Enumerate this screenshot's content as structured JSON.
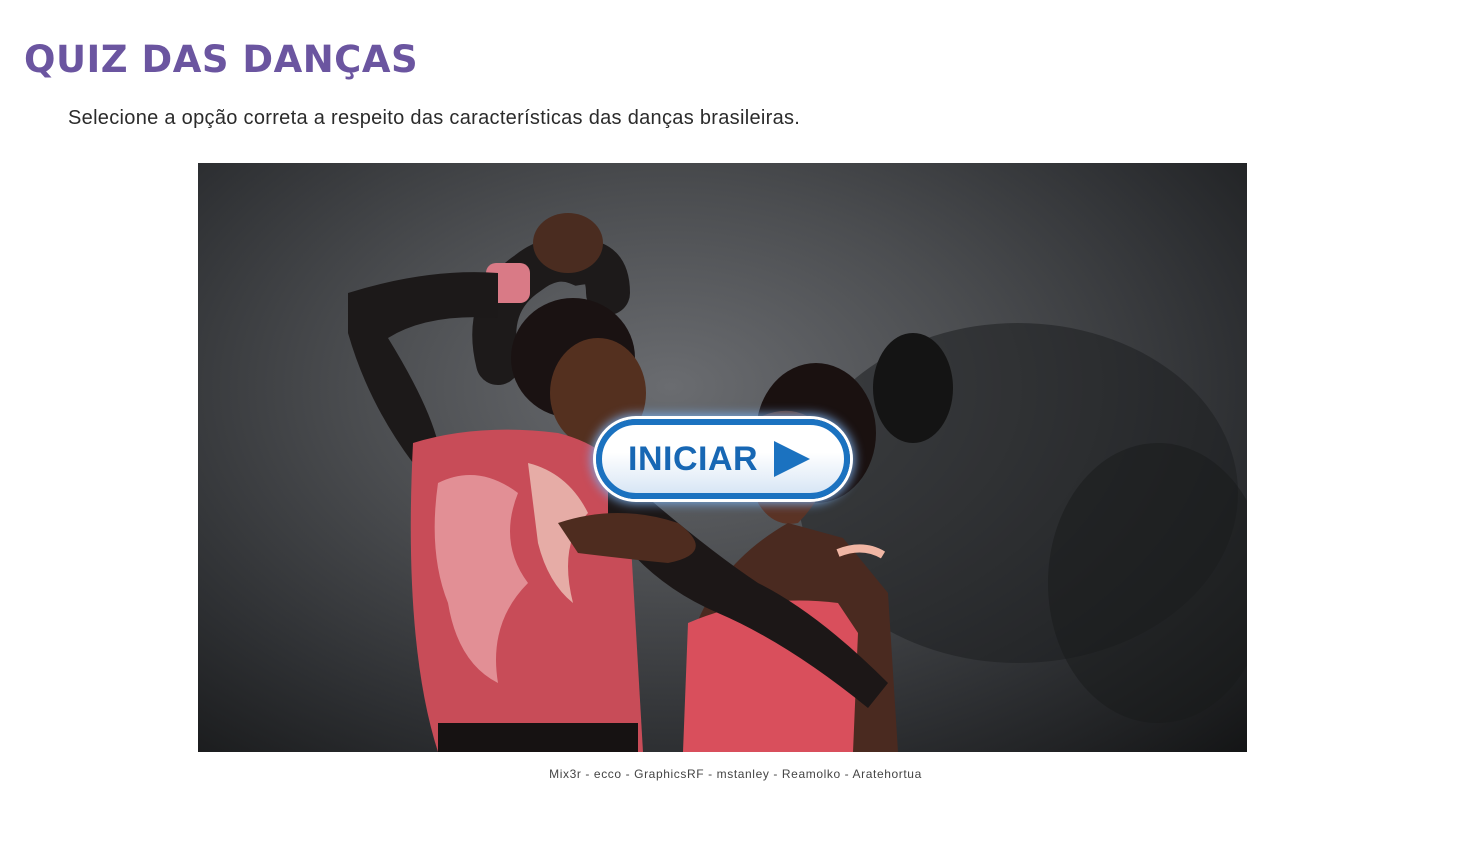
{
  "header": {
    "title": "QUIZ DAS DANÇAS",
    "instruction": "Selecione a opção correta a respeito das características das danças brasileiras."
  },
  "media": {
    "image_description": "Dancing couple",
    "start_button_label": "INICIAR",
    "start_button_icon": "play-icon",
    "credits": "Mix3r - ecco - GraphicsRF - mstanley - Reamolko - Aratehortua"
  },
  "colors": {
    "title": "#6b55a0",
    "button_border": "#1b72c0",
    "button_text": "#1767b4"
  }
}
